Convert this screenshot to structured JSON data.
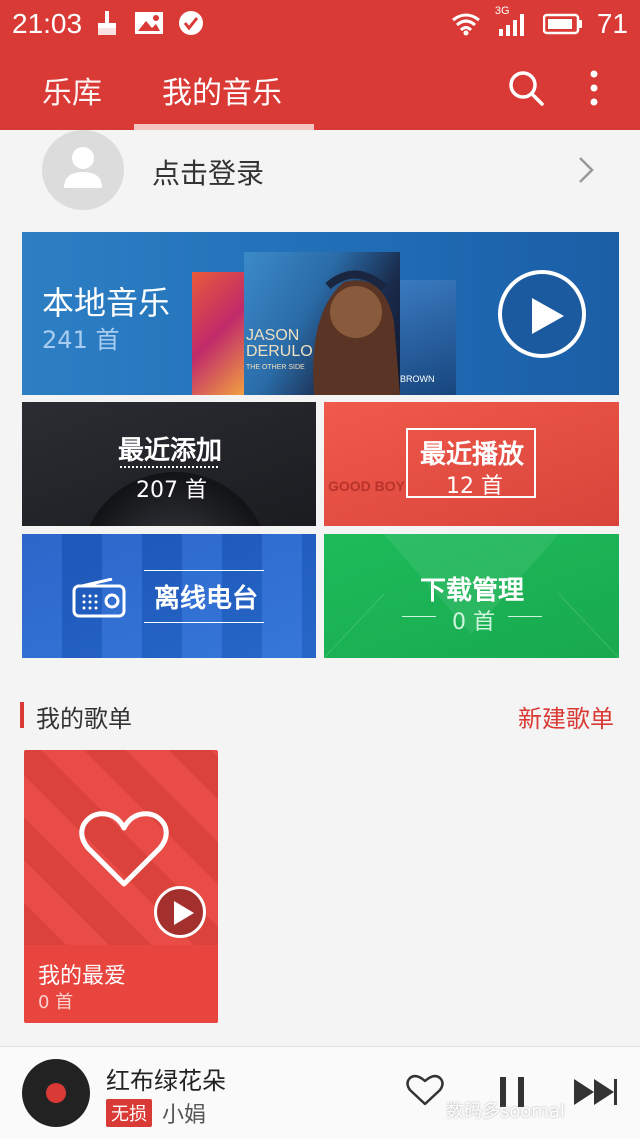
{
  "status_bar": {
    "time": "21:03",
    "network": "3G",
    "battery": "71"
  },
  "nav": {
    "tabs": [
      "乐库",
      "我的音乐"
    ],
    "active_tab": "我的音乐"
  },
  "login": {
    "label": "点击登录"
  },
  "local_music": {
    "title": "本地音乐",
    "count": "241 首",
    "album_text": "JASON DERULO",
    "album_sub": "THE OTHER SIDE",
    "album_brown": "BROWN"
  },
  "tiles": {
    "recent_add": {
      "title": "最近添加",
      "count": "207 首"
    },
    "recent_play": {
      "title": "最近播放",
      "count": "12 首",
      "bg_text": "GOOD BOY"
    },
    "radio": {
      "title": "离线电台"
    },
    "download": {
      "title": "下载管理",
      "count": "0 首"
    }
  },
  "playlists": {
    "section_title": "我的歌单",
    "new_label": "新建歌单",
    "items": [
      {
        "name": "我的最爱",
        "count": "0 首"
      }
    ]
  },
  "player": {
    "song": "红布绿花朵",
    "quality_badge": "无损",
    "artist": "小娟"
  },
  "watermark": "数码多soomal",
  "colors": {
    "brand_red": "#d93a35",
    "local_blue": "#1f6cb5",
    "radio_blue": "#2a6fd8",
    "download_green": "#1dbb5a",
    "recent_play_red": "#f05a4c",
    "recent_add_dark": "#1b1c20"
  }
}
